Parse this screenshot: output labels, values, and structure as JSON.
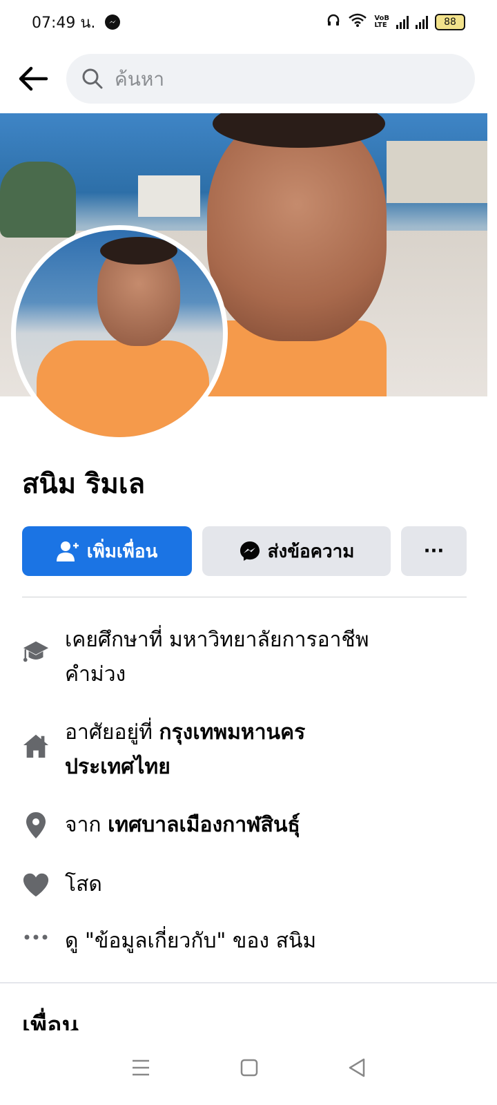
{
  "status_bar": {
    "time": "07:49 น.",
    "battery": "88",
    "volte_top": "VoB",
    "volte_bottom": "LTE"
  },
  "search": {
    "placeholder": "ค้นหา"
  },
  "profile": {
    "name": "สนิม ริมเล"
  },
  "actions": {
    "add_friend": "เพิ่มเพื่อน",
    "message": "ส่งข้อความ",
    "more": "···"
  },
  "intro": {
    "education_prefix": "เคยศึกษาที่ มหาวิทยาลัยการอาชีพ",
    "education_line2": "คำม่วง",
    "lives_prefix": "อาศัยอยู่ที่ ",
    "lives_city": "กรุงเทพมหานคร",
    "lives_country": "ประเทศไทย",
    "from_prefix": "จาก ",
    "from_place": "เทศบาลเมืองกาฬสินธุ์",
    "relationship": "โสด",
    "see_about": "ดู \"ข้อมูลเกี่ยวกับ\" ของ สนิม"
  },
  "friends": {
    "heading": "เพื่อน"
  },
  "colors": {
    "primary": "#1b74e4",
    "secondary_button": "#e4e6eb",
    "icon_gray": "#65676b"
  }
}
